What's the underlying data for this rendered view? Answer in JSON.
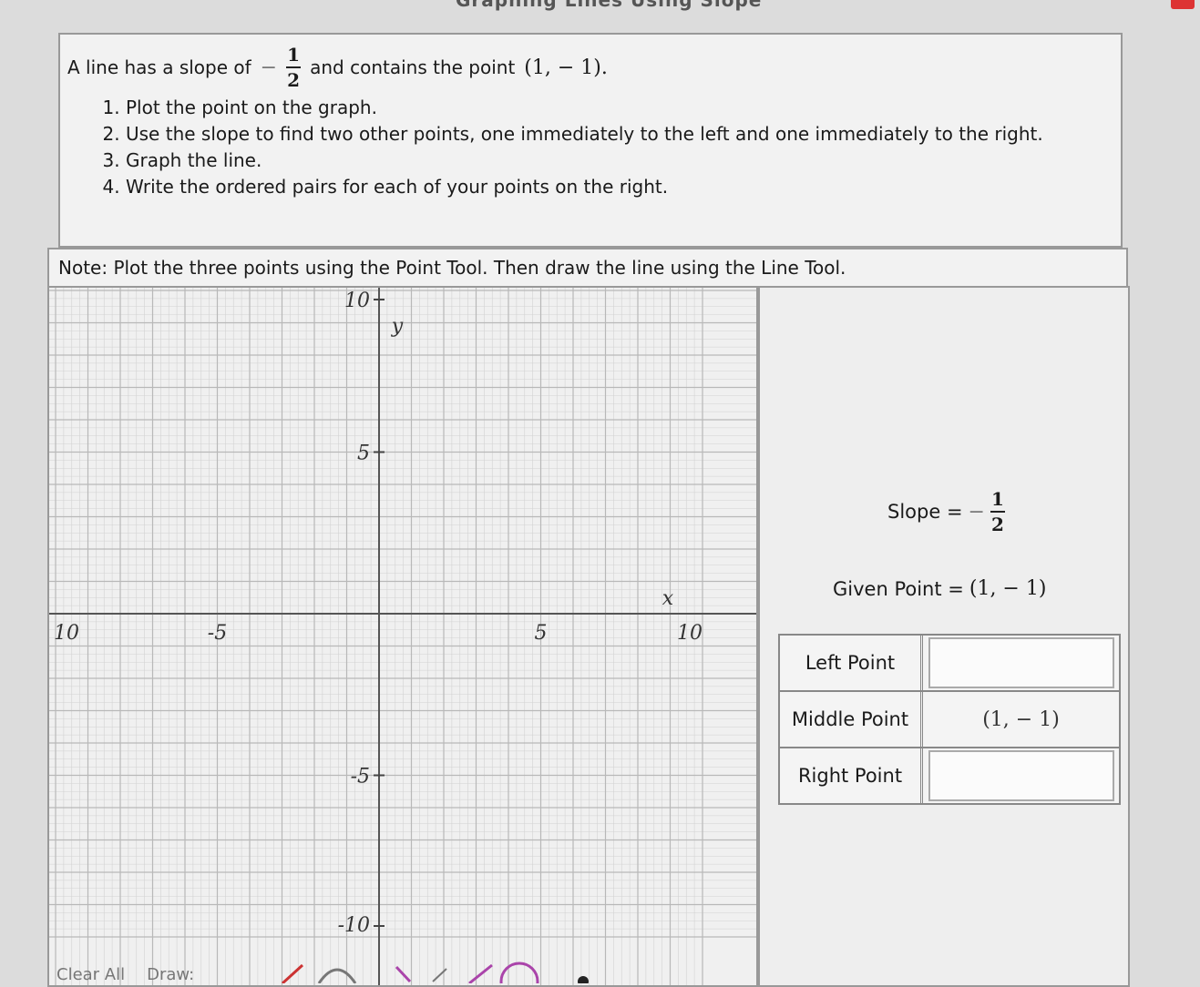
{
  "header": {
    "title": "Graphing Lines Using Slope"
  },
  "problem": {
    "statement_prefix": "A line has a slope of",
    "slope_sign": "−",
    "slope_num": "1",
    "slope_den": "2",
    "statement_middle": "and contains the point",
    "point": "(1, − 1).",
    "steps": [
      "Plot the point on the graph.",
      "Use the slope to find two other points, one immediately to the left and one immediately to the right.",
      "Graph the line.",
      "Write the ordered pairs for each of your points on the right."
    ]
  },
  "note": "Note: Plot the three points using the Point Tool. Then draw the line using the Line Tool.",
  "graph": {
    "x_axis_label": "x",
    "y_axis_label": "y",
    "x_ticks": [
      "10",
      "-5",
      "5",
      "10"
    ],
    "y_ticks": [
      "10",
      "5",
      "-5",
      "-10"
    ],
    "range": [
      -10,
      10
    ]
  },
  "info": {
    "slope_label": "Slope =",
    "slope_sign": "−",
    "slope_num": "1",
    "slope_den": "2",
    "given_label": "Given Point =",
    "given_value": "(1, − 1)"
  },
  "points_table": {
    "rows": [
      {
        "label": "Left Point",
        "value": ""
      },
      {
        "label": "Middle Point",
        "value": "(1, − 1)"
      },
      {
        "label": "Right Point",
        "value": ""
      }
    ]
  },
  "toolbar": {
    "clear_all": "Clear All",
    "draw": "Draw:"
  }
}
